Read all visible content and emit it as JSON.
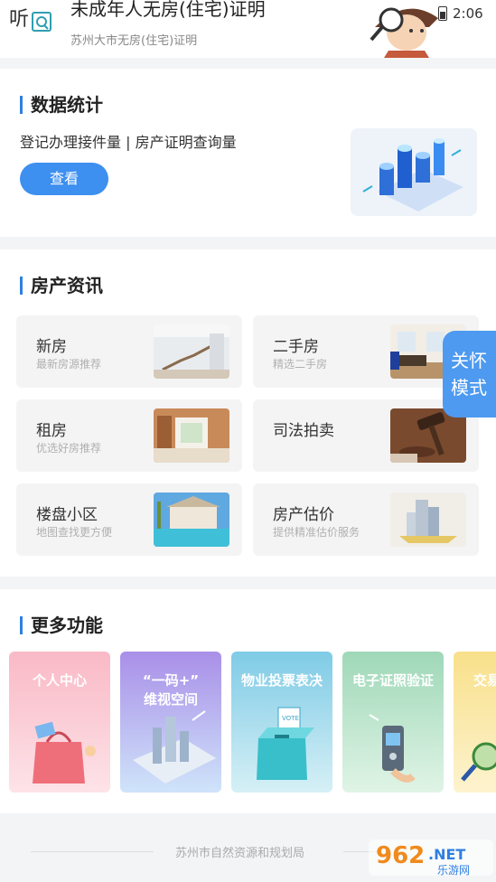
{
  "header": {
    "title": "未成年人无房(住宅)证明",
    "subtitle": "苏州大市无房(住宅)证明",
    "status_time": "2:06"
  },
  "stats": {
    "title": "数据统计",
    "description": "登记办理接件量 | 房产证明查询量",
    "button": "查看"
  },
  "news": {
    "title": "房产资讯",
    "tiles": [
      {
        "title": "新房",
        "subtitle": "最新房源推荐"
      },
      {
        "title": "二手房",
        "subtitle": "精选二手房"
      },
      {
        "title": "租房",
        "subtitle": "优选好房推荐"
      },
      {
        "title": "司法拍卖",
        "subtitle": ""
      },
      {
        "title": "楼盘小区",
        "subtitle": "地图查找更方便"
      },
      {
        "title": "房产估价",
        "subtitle": "提供精准估价服务"
      }
    ]
  },
  "care_mode": {
    "line1": "关怀",
    "line2": "模式"
  },
  "more": {
    "title": "更多功能",
    "items": [
      {
        "line1": "个人中心",
        "line2": ""
      },
      {
        "line1": "“一码+”",
        "line2": "维视空间"
      },
      {
        "line1": "物业投票表决",
        "line2": ""
      },
      {
        "line1": "电子证照验证",
        "line2": ""
      },
      {
        "line1": "交易",
        "line2": ""
      }
    ]
  },
  "footer": {
    "text": "苏州市自然资源和规划局"
  },
  "watermark": {
    "big": "962",
    "suffix": ".NET",
    "small": "乐游网"
  },
  "colors": {
    "accent": "#3d8ff0",
    "care": "#4d9af0"
  }
}
